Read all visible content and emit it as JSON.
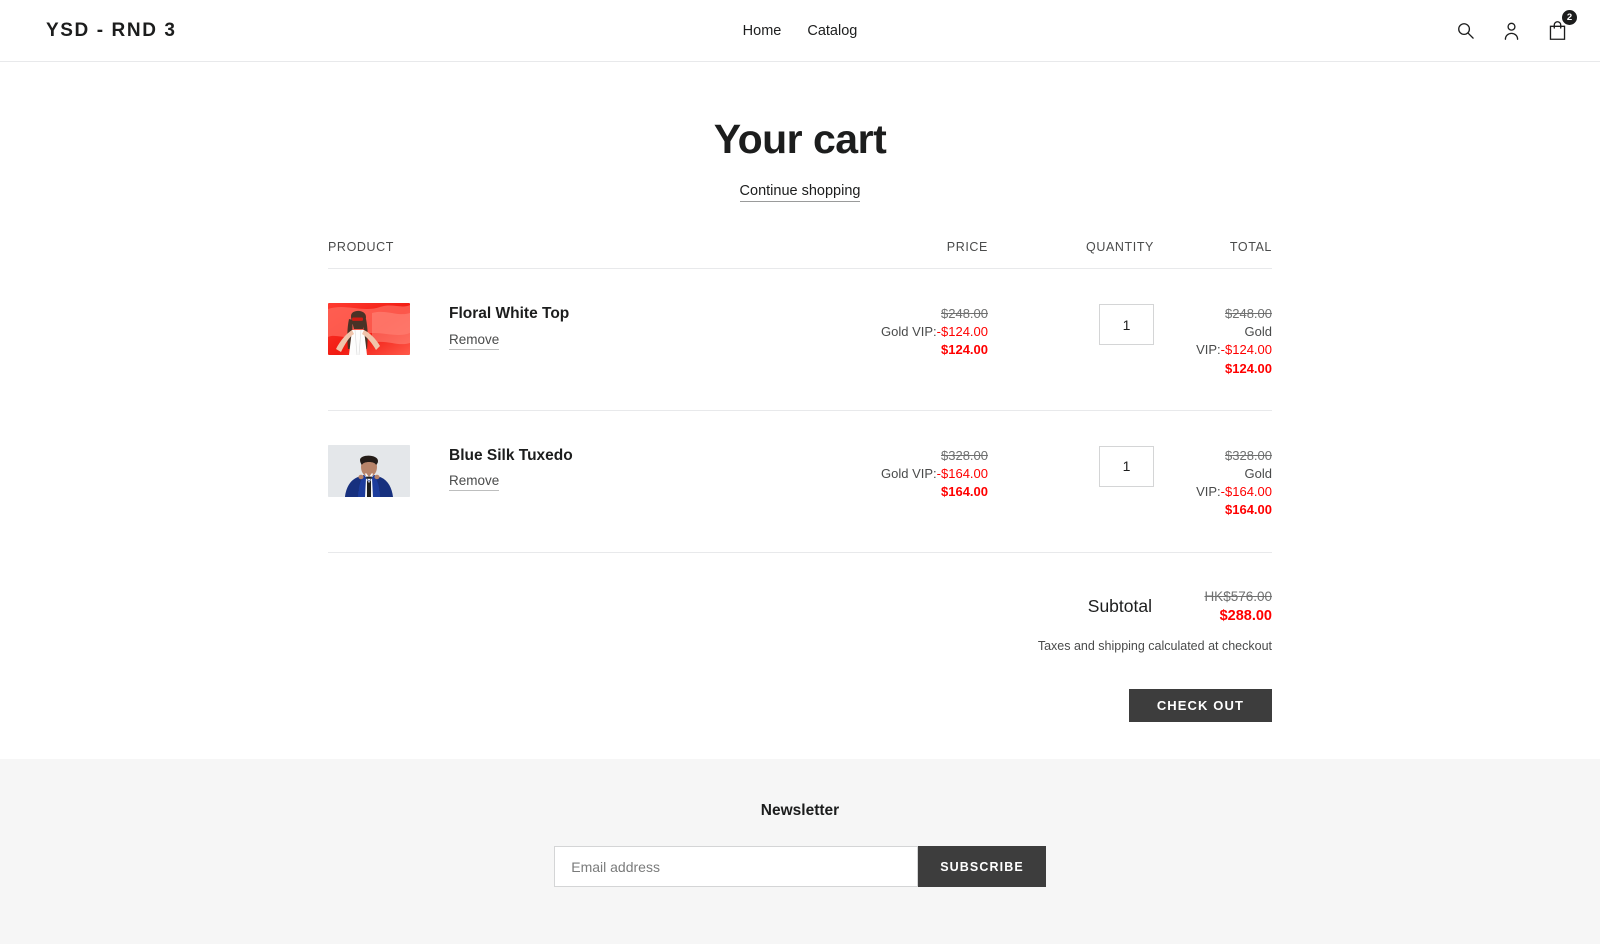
{
  "header": {
    "logo": "YSD - RND 3",
    "nav": [
      {
        "label": "Home"
      },
      {
        "label": "Catalog"
      }
    ],
    "icons": {
      "search": "search-icon",
      "account": "account-icon",
      "cart": "shopping-bag-icon"
    },
    "cart_count": "2"
  },
  "page": {
    "title": "Your cart",
    "continue_shopping": "Continue shopping"
  },
  "table": {
    "columns": {
      "product": "PRODUCT",
      "price": "PRICE",
      "quantity": "QUANTITY",
      "total": "TOTAL"
    },
    "rows": [
      {
        "name": "Floral White Top",
        "remove_label": "Remove",
        "image_alt": "woman-in-white-top-with-red-fabric",
        "price": {
          "original": "$248.00",
          "discount_label": "Gold VIP:",
          "discount_value": "-$124.00",
          "final": "$124.00"
        },
        "quantity": "1",
        "total": {
          "original": "$248.00",
          "discount_label_line1": "Gold",
          "discount_label_line2": "VIP:",
          "discount_value": "-$124.00",
          "final": "$124.00"
        }
      },
      {
        "name": "Blue Silk Tuxedo",
        "remove_label": "Remove",
        "image_alt": "man-in-blue-tuxedo-adjusting-bow-tie",
        "price": {
          "original": "$328.00",
          "discount_label": "Gold VIP:",
          "discount_value": "-$164.00",
          "final": "$164.00"
        },
        "quantity": "1",
        "total": {
          "original": "$328.00",
          "discount_label_line1": "Gold",
          "discount_label_line2": "VIP:",
          "discount_value": "-$164.00",
          "final": "$164.00"
        }
      }
    ]
  },
  "totals": {
    "subtotal_label": "Subtotal",
    "subtotal_original": "HK$576.00",
    "subtotal_final": "$288.00",
    "tax_note": "Taxes and shipping calculated at checkout",
    "checkout_label": "CHECK OUT"
  },
  "footer": {
    "newsletter_title": "Newsletter",
    "email_placeholder": "Email address",
    "email_value": "",
    "subscribe_label": "SUBSCRIBE"
  },
  "colors": {
    "accent_discount": "#ff0000",
    "button_dark": "#3d3d3d",
    "text": "#1c1d1d",
    "footer_bg": "#f6f6f6"
  }
}
